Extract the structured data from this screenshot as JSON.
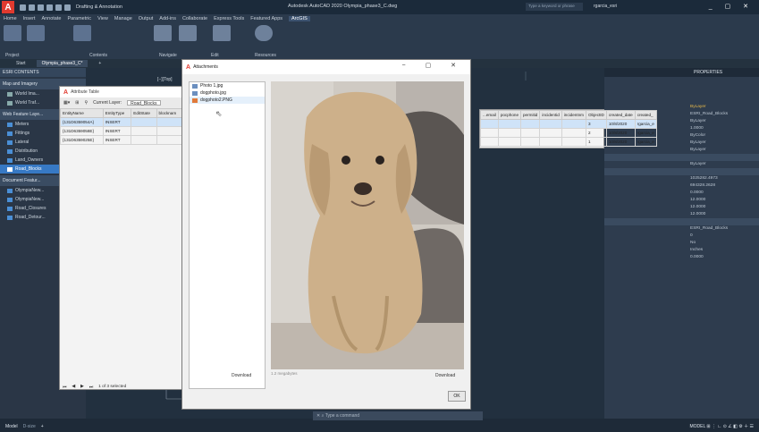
{
  "titlebar": {
    "workspace": "Drafting & Annotation",
    "menus": [
      "Home",
      "Insert",
      "Annotate",
      "Parametric",
      "View",
      "Manage",
      "Output",
      "Add-ins",
      "Collaborate",
      "Express Tools",
      "Featured Apps",
      "ArcGIS"
    ],
    "title": "Autodesk AutoCAD 2020 Olympia_phase3_C.dwg",
    "search_placeholder": "Type a keyword or phrase",
    "user": "rgarcia_esri"
  },
  "ribbon": {
    "panels": [
      "Project",
      "Contents",
      "Navigate",
      "Edit",
      "Resources"
    ]
  },
  "tabs": {
    "start": "Start",
    "doc": "Olympia_phase3_C*"
  },
  "esri": {
    "header": "ESRI CONTENTS",
    "section1": "Map and Imagery",
    "maps": [
      "World Ima...",
      "World Traf..."
    ],
    "section2": "Web Feature Laye...",
    "layers": [
      "Meters",
      "Fittings",
      "Lateral",
      "Distribution",
      "Land_Owners",
      "Road_Blocks"
    ],
    "section3": "Document Featur...",
    "docs": [
      "OlympiaNew...",
      "OlympiaNew...",
      "Road_Closures",
      "Road_Detour..."
    ]
  },
  "attribute_table": {
    "title": "Attribute Table",
    "current_layer_label": "Current Layer:",
    "current_layer": "Road_Blocks",
    "columns": [
      "EntityName",
      "EntityType",
      "EditState",
      "blocknam"
    ],
    "rows": [
      [
        "{131D6359054A}",
        "INSERT",
        "",
        ""
      ],
      [
        "{131D6359058E}",
        "INSERT",
        "",
        ""
      ],
      [
        "{131D6359025E}",
        "INSERT",
        "",
        ""
      ]
    ],
    "footer": "1 of 3 selected"
  },
  "attachments": {
    "title": "Attachments",
    "files": [
      "Photo 1.jpg",
      "dogphoto.jpg",
      "dogphoto2.PNG"
    ],
    "caption": "1.2 megabytes",
    "download_left": "Download",
    "download_right": "Download",
    "ok": "OK"
  },
  "right_table": {
    "columns": [
      "...email",
      "pocphone",
      "permitid",
      "incidentid",
      "incidentnm",
      "ObjectID",
      "created_date",
      "created_"
    ],
    "rows": [
      [
        "",
        "",
        "",
        "",
        "",
        "3",
        "10/8/2020",
        "rgarcia_e"
      ],
      [
        "",
        "",
        "",
        "",
        "",
        "2",
        "10/8/2020",
        "rgarcia_e"
      ],
      [
        "",
        "",
        "",
        "",
        "",
        "1",
        "10/8/2020",
        "rgarcia_e"
      ]
    ]
  },
  "properties": {
    "header": "PROPERTIES",
    "rows": [
      "ByLayer",
      "ESRI_Road_Blocks",
      "ByLayer",
      "1.0000",
      "ByColor",
      "ByLayer",
      "ByLayer",
      "",
      "ByLayer",
      "",
      "1025282.4973",
      "694328.2628",
      "0.0000",
      "12.0000",
      "12.0000",
      "12.0000",
      "",
      "ESRI_Road_Blocks",
      "0",
      "No",
      "Inches",
      "0.0000"
    ]
  },
  "command": {
    "placeholder": "Type a command"
  },
  "status": {
    "model": "Model",
    "layout": "D-size",
    "mode": "MODEL"
  },
  "colors": {
    "accent": "#3779c4",
    "brand": "#e03a2f"
  }
}
